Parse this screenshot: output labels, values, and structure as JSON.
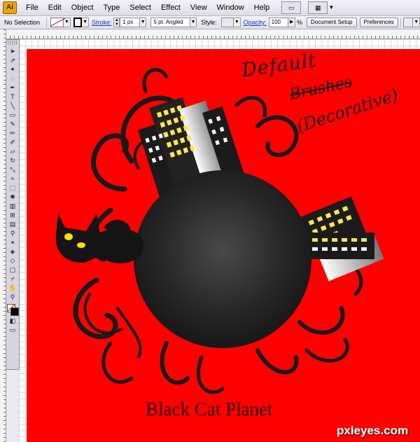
{
  "app": {
    "icon_label": "Ai"
  },
  "menu": [
    "File",
    "Edit",
    "Object",
    "Type",
    "Select",
    "Effect",
    "View",
    "Window",
    "Help"
  ],
  "control_bar": {
    "selection_label": "No Selection",
    "stroke_label": "Stroke:",
    "stroke_weight": "1 px",
    "brush_label": "5 pt. Angled",
    "style_label": "Style:",
    "opacity_label": "Opacity:",
    "opacity_value": "100",
    "opacity_unit": "%",
    "document_setup": "Document Setup",
    "preferences": "Preferences"
  },
  "toolbox": {
    "tools": [
      "selection-tool",
      "direct-selection-tool",
      "magic-wand-tool",
      "lasso-tool",
      "pen-tool",
      "type-tool",
      "line-tool",
      "rectangle-tool",
      "paintbrush-tool",
      "pencil-tool",
      "blob-brush-tool",
      "eraser-tool",
      "rotate-tool",
      "scale-tool",
      "warp-tool",
      "free-transform-tool",
      "symbol-sprayer-tool",
      "column-graph-tool",
      "mesh-tool",
      "gradient-tool",
      "eyedropper-tool",
      "blend-tool",
      "live-paint-bucket-tool",
      "live-paint-selection-tool",
      "artboard-tool",
      "slice-tool",
      "hand-tool",
      "zoom-tool"
    ]
  },
  "artwork": {
    "title": "Black Cat Planet",
    "handwriting": [
      "Default",
      "Brushes",
      "(Decorative)"
    ],
    "background_color": "#ff0000"
  },
  "watermark": "pxleyes.com"
}
